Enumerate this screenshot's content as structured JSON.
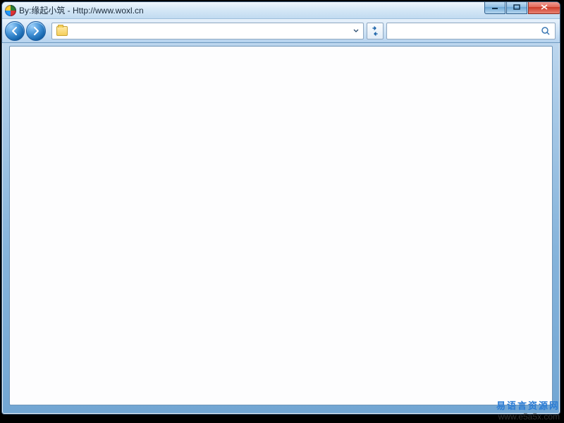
{
  "window": {
    "title": "By:缘起小筑 - Http://www.woxl.cn"
  },
  "address": {
    "value": ""
  },
  "search": {
    "placeholder": ""
  },
  "watermark": {
    "line1": "易语言资源网",
    "line2": "www.e5a5x.com"
  }
}
